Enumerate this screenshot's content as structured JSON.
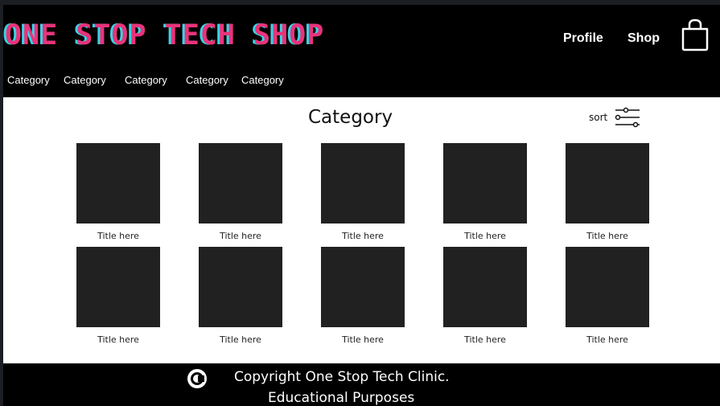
{
  "header": {
    "logo": "ONE STOP TECH SHOP",
    "nav": {
      "profile": "Profile",
      "shop": "Shop"
    },
    "cart_icon": "shopping-bag-icon",
    "categories": [
      "Category",
      "Category",
      "Category",
      "Category",
      "Category"
    ]
  },
  "main": {
    "title": "Category",
    "sort_label": "sort",
    "sort_icon": "sliders-icon",
    "products": [
      {
        "title": "Title here"
      },
      {
        "title": "Title here"
      },
      {
        "title": "Title here"
      },
      {
        "title": "Title here"
      },
      {
        "title": "Title here"
      },
      {
        "title": "Title here"
      },
      {
        "title": "Title here"
      },
      {
        "title": "Title here"
      },
      {
        "title": "Title here"
      },
      {
        "title": "Title here"
      }
    ]
  },
  "footer": {
    "copyright_icon": "copyright-icon",
    "line1": "Copyright One Stop Tech Clinic.",
    "line2": "Educational Purposes"
  },
  "colors": {
    "background": "#000000",
    "logo_pink": "#e8337a",
    "logo_cyan": "#37d4e6",
    "thumbnail": "#212121"
  }
}
